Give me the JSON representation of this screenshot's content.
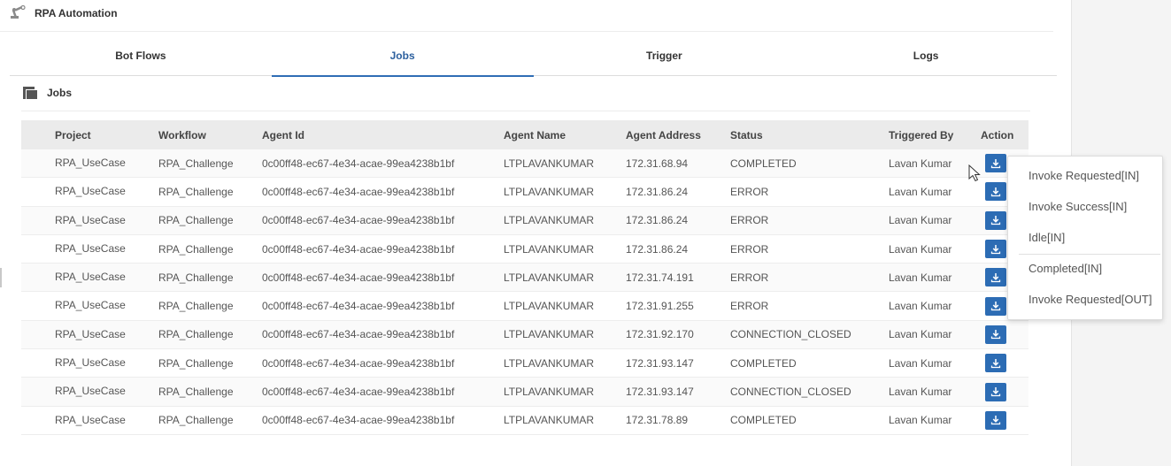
{
  "app": {
    "title": "RPA Automation",
    "icon": "robot-arm-icon"
  },
  "tabs": [
    {
      "label": "Bot Flows",
      "active": false
    },
    {
      "label": "Jobs",
      "active": true
    },
    {
      "label": "Trigger",
      "active": false
    },
    {
      "label": "Logs",
      "active": false
    }
  ],
  "section": {
    "title": "Jobs",
    "icon": "layers-icon"
  },
  "table": {
    "headers": {
      "project": "Project",
      "workflow": "Workflow",
      "agent_id": "Agent Id",
      "agent_name": "Agent Name",
      "agent_address": "Agent Address",
      "status": "Status",
      "triggered_by": "Triggered By",
      "action": "Action"
    },
    "rows": [
      {
        "project": "RPA_UseCase",
        "workflow": "RPA_Challenge",
        "agent_id": "0c00ff48-ec67-4e34-acae-99ea4238b1bf",
        "agent_name": "LTPLAVANKUMAR",
        "agent_address": "172.31.68.94",
        "status": "COMPLETED",
        "triggered_by": "Lavan Kumar"
      },
      {
        "project": "RPA_UseCase",
        "workflow": "RPA_Challenge",
        "agent_id": "0c00ff48-ec67-4e34-acae-99ea4238b1bf",
        "agent_name": "LTPLAVANKUMAR",
        "agent_address": "172.31.86.24",
        "status": "ERROR",
        "triggered_by": "Lavan Kumar"
      },
      {
        "project": "RPA_UseCase",
        "workflow": "RPA_Challenge",
        "agent_id": "0c00ff48-ec67-4e34-acae-99ea4238b1bf",
        "agent_name": "LTPLAVANKUMAR",
        "agent_address": "172.31.86.24",
        "status": "ERROR",
        "triggered_by": "Lavan Kumar"
      },
      {
        "project": "RPA_UseCase",
        "workflow": "RPA_Challenge",
        "agent_id": "0c00ff48-ec67-4e34-acae-99ea4238b1bf",
        "agent_name": "LTPLAVANKUMAR",
        "agent_address": "172.31.86.24",
        "status": "ERROR",
        "triggered_by": "Lavan Kumar"
      },
      {
        "project": "RPA_UseCase",
        "workflow": "RPA_Challenge",
        "agent_id": "0c00ff48-ec67-4e34-acae-99ea4238b1bf",
        "agent_name": "LTPLAVANKUMAR",
        "agent_address": "172.31.74.191",
        "status": "ERROR",
        "triggered_by": "Lavan Kumar"
      },
      {
        "project": "RPA_UseCase",
        "workflow": "RPA_Challenge",
        "agent_id": "0c00ff48-ec67-4e34-acae-99ea4238b1bf",
        "agent_name": "LTPLAVANKUMAR",
        "agent_address": "172.31.91.255",
        "status": "ERROR",
        "triggered_by": "Lavan Kumar"
      },
      {
        "project": "RPA_UseCase",
        "workflow": "RPA_Challenge",
        "agent_id": "0c00ff48-ec67-4e34-acae-99ea4238b1bf",
        "agent_name": "LTPLAVANKUMAR",
        "agent_address": "172.31.92.170",
        "status": "CONNECTION_CLOSED",
        "triggered_by": "Lavan Kumar"
      },
      {
        "project": "RPA_UseCase",
        "workflow": "RPA_Challenge",
        "agent_id": "0c00ff48-ec67-4e34-acae-99ea4238b1bf",
        "agent_name": "LTPLAVANKUMAR",
        "agent_address": "172.31.93.147",
        "status": "COMPLETED",
        "triggered_by": "Lavan Kumar"
      },
      {
        "project": "RPA_UseCase",
        "workflow": "RPA_Challenge",
        "agent_id": "0c00ff48-ec67-4e34-acae-99ea4238b1bf",
        "agent_name": "LTPLAVANKUMAR",
        "agent_address": "172.31.93.147",
        "status": "CONNECTION_CLOSED",
        "triggered_by": "Lavan Kumar"
      },
      {
        "project": "RPA_UseCase",
        "workflow": "RPA_Challenge",
        "agent_id": "0c00ff48-ec67-4e34-acae-99ea4238b1bf",
        "agent_name": "LTPLAVANKUMAR",
        "agent_address": "172.31.78.89",
        "status": "COMPLETED",
        "triggered_by": "Lavan Kumar"
      }
    ],
    "action_icon": "download-icon"
  },
  "dropdown": {
    "items": [
      "Invoke Requested[IN]",
      "Invoke Success[IN]",
      "Idle[IN]",
      "Completed[IN]",
      "Invoke Requested[OUT]"
    ]
  },
  "colors": {
    "accent": "#2c6cb4",
    "active_tab_text": "#2b5f9e",
    "header_bg": "#ebebeb"
  }
}
